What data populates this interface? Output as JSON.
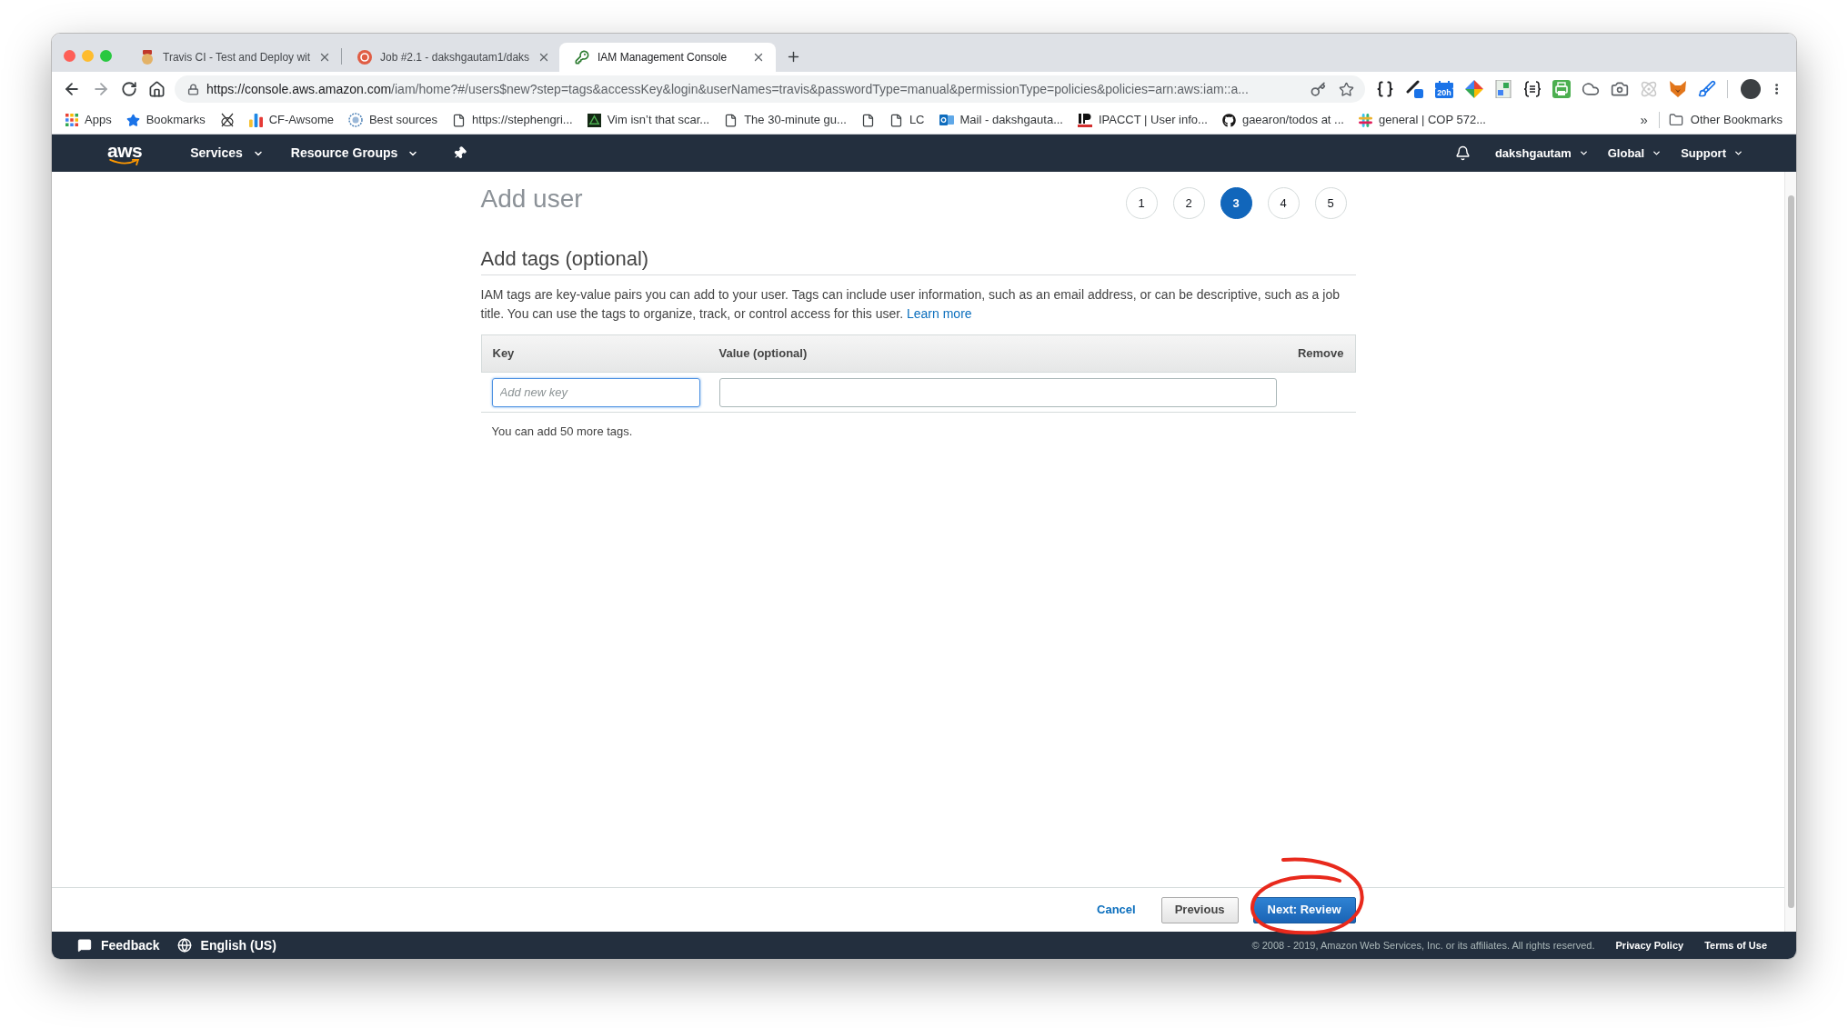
{
  "browser": {
    "tabs": [
      {
        "title": "Travis CI - Test and Deploy wit",
        "selected": false
      },
      {
        "title": "Job #2.1 - dakshgautam1/daks",
        "selected": false
      },
      {
        "title": "IAM Management Console",
        "selected": true
      }
    ],
    "address": {
      "origin": "https://console.aws.amazon.com",
      "path": "/iam/home?#/users$new?step=tags&accessKey&login&userNames=travis&passwordType=manual&permissionType=policies&policies=arn:aws:iam::a..."
    },
    "extension_badge": "20h",
    "bookmarks": [
      "Apps",
      "Bookmarks",
      "CF-Awsome",
      "Best sources",
      "https://stephengri...",
      "Vim isn’t that scar...",
      "The 30-minute gu...",
      "LC",
      "Mail - dakshgauta...",
      "IPACCT | User info...",
      "gaearon/todos at ...",
      "general | COP 572..."
    ],
    "bookmarks_overflow": "»",
    "other_bookmarks": "Other Bookmarks"
  },
  "console_nav": {
    "logo": "aws",
    "left_menus": [
      "Services",
      "Resource Groups"
    ],
    "right_menus": [
      "dakshgautam",
      "Global",
      "Support"
    ]
  },
  "page": {
    "title": "Add user",
    "steps": [
      {
        "label": "1",
        "selected": false
      },
      {
        "label": "2",
        "selected": false
      },
      {
        "label": "3",
        "selected": true
      },
      {
        "label": "4",
        "selected": false
      },
      {
        "label": "5",
        "selected": false
      }
    ],
    "section_title": "Add tags (optional)",
    "description": "IAM tags are key-value pairs you can add to your user. Tags can include user information, such as an email address, or can be descriptive, such as a job title. You can use the tags to organize, track, or control access for this user.",
    "learn_more": "Learn more",
    "table": {
      "columns": [
        "Key",
        "Value (optional)",
        "Remove"
      ],
      "rows": [
        {
          "key": {
            "placeholder": "Add new key",
            "focused": true
          },
          "value": {
            "focused": false
          }
        }
      ]
    },
    "remaining": "You can add 50 more tags."
  },
  "actions": [
    {
      "label": "Cancel",
      "kind": "link"
    },
    {
      "label": "Previous",
      "kind": "secondary"
    },
    {
      "label": "Next: Review",
      "kind": "primary"
    }
  ],
  "footer": {
    "feedback": "Feedback",
    "language": "English (US)",
    "copyright": "© 2008 - 2019, Amazon Web Services, Inc. or its affiliates. All rights reserved.",
    "links": [
      "Privacy Policy",
      "Terms of Use"
    ]
  }
}
